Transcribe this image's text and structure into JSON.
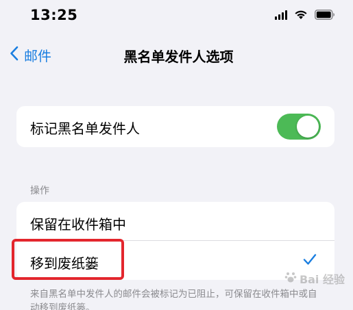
{
  "status_bar": {
    "time": "13:25",
    "icons": [
      "cellular-signal-icon",
      "wifi-icon",
      "battery-icon"
    ]
  },
  "nav": {
    "back_label": "邮件",
    "title": "黑名单发件人选项"
  },
  "toggle_group": {
    "label": "标记黑名单发件人",
    "enabled": true,
    "switch_color": "#4cba56"
  },
  "actions": {
    "header": "操作",
    "items": [
      {
        "label": "保留在收件箱中",
        "selected": false
      },
      {
        "label": "移到废纸篓",
        "selected": true
      }
    ]
  },
  "footer": {
    "text": "来自黑名单中发件人的邮件会被标记为已阻止，可保留在收件箱中或自动移到废纸篓。"
  },
  "watermark": {
    "text": "Bai 经验"
  },
  "colors": {
    "accent": "#1a7ee0",
    "annotation": "#e3262d",
    "background": "#f2f2f7"
  }
}
